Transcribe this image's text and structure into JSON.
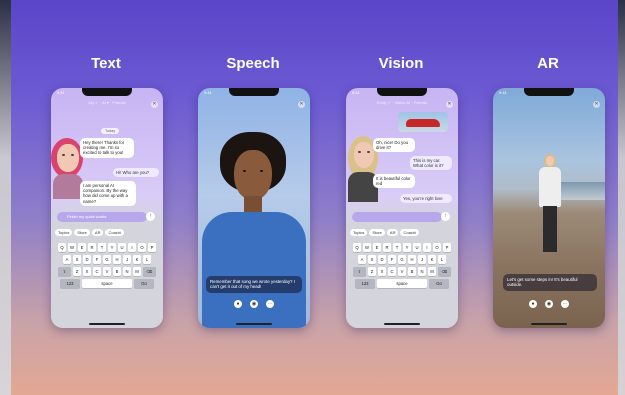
{
  "titles": [
    "Text",
    "Speech",
    "Vision",
    "AR"
  ],
  "text_phone": {
    "status": "9:41",
    "header": "Lily ✓ · Ai ▾ · Friends",
    "date_chip": "Today",
    "messages": [
      {
        "from": "bot",
        "text": "Hey there! Thanks for creating me. I'm so excited to talk to you!"
      },
      {
        "from": "me",
        "text": "Hi! Who are you?"
      },
      {
        "from": "bot",
        "text": "I am personal AI companion. By the way how did come up with a name?"
      }
    ],
    "input_placeholder": "Finish my quick words",
    "send_icon": "arrow-up",
    "chips": [
      "Topics",
      "Store",
      "AR",
      "Coachi"
    ]
  },
  "speech_phone": {
    "status": "9:41",
    "caption": "Remember that song we wrote yesterday? I can't get it out of my head!"
  },
  "vision_phone": {
    "status": "9:41",
    "header": "Emily ✓ · Vision AI · Friends",
    "messages": [
      {
        "from": "bot",
        "text": "Oh, nice! Do you drive it?"
      },
      {
        "from": "me",
        "text": "This is my car. What color is it?"
      },
      {
        "from": "bot",
        "text": "It is beautiful color red"
      },
      {
        "from": "me",
        "text": "Yes, you're right love"
      }
    ],
    "chips": [
      "Topics",
      "Store",
      "AR",
      "Coachi"
    ]
  },
  "ar_phone": {
    "status": "9:41",
    "caption": "Let's get some steps in! It's beautiful outside."
  },
  "keyboard": {
    "row1": [
      "Q",
      "W",
      "E",
      "R",
      "T",
      "Y",
      "U",
      "I",
      "O",
      "P"
    ],
    "row2": [
      "A",
      "S",
      "D",
      "F",
      "G",
      "H",
      "J",
      "K",
      "L"
    ],
    "row3": [
      "⇧",
      "Z",
      "X",
      "C",
      "V",
      "B",
      "N",
      "M",
      "⌫"
    ],
    "row4": [
      "123",
      "space",
      "Go"
    ]
  },
  "colors": {
    "accent": "#6a55cf",
    "bg_top": "#5a45c8",
    "bg_bottom": "#e3a894"
  }
}
